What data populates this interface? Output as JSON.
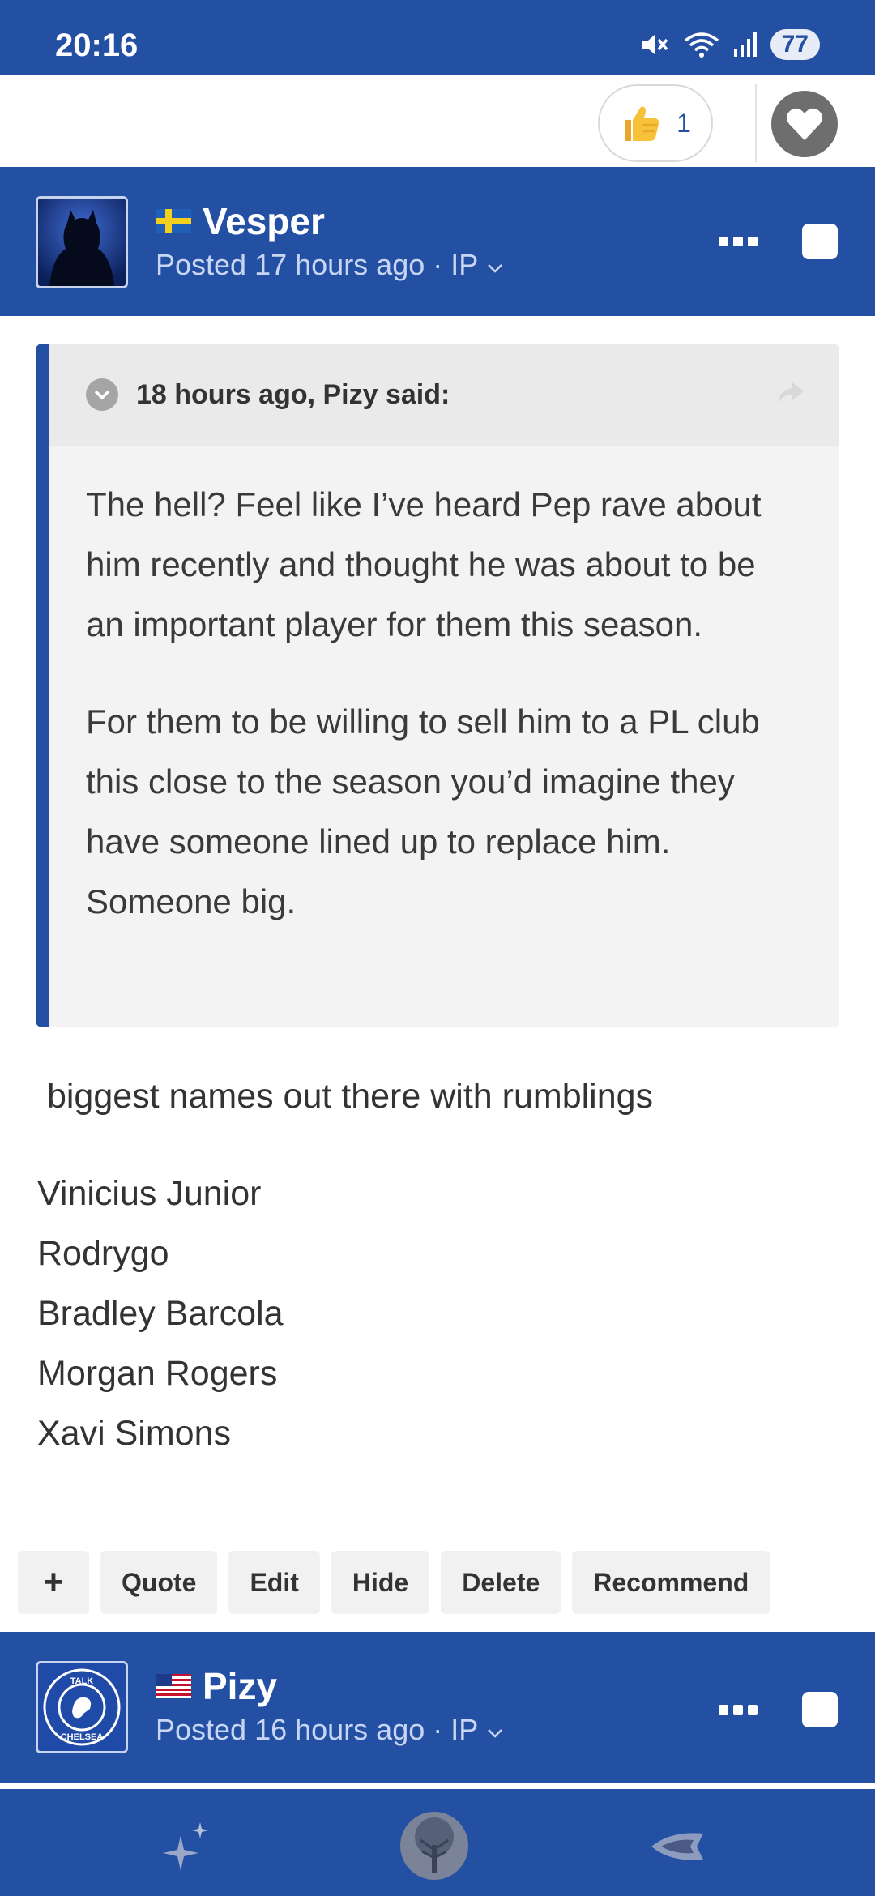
{
  "status_bar": {
    "time": "20:16",
    "battery": "77",
    "icons": [
      "mute-icon",
      "wifi-icon",
      "signal-icon"
    ]
  },
  "previous_post": {
    "reaction_count": "1",
    "reaction_icon": "thumbs-up-icon"
  },
  "posts": [
    {
      "author": "Vesper",
      "flag": "sweden-flag-icon",
      "posted": "Posted 17 hours ago · IP",
      "quote": {
        "citation": "18 hours ago, Pizy said:",
        "paragraphs": [
          "The hell? Feel like I’ve heard Pep rave about him recently and thought he was about to be an important player for them this season.",
          "For them to be willing to sell him to a PL club this close to the season you’d imagine they have someone lined up to replace him. Someone big."
        ]
      },
      "body": " biggest names out there with rumblings",
      "names": [
        "Vinicius Junior",
        "Rodrygo",
        "Bradley Barcola",
        "Morgan Rogers",
        "Xavi Simons"
      ],
      "actions": {
        "plus": "+",
        "quote": "Quote",
        "edit": "Edit",
        "hide": "Hide",
        "delete": "Delete",
        "recommend": "Recommend"
      }
    },
    {
      "author": "Pizy",
      "flag": "usa-flag-icon",
      "posted": "Posted 16 hours ago · IP",
      "avatar_text": [
        "TALK",
        "CHELSEA"
      ]
    }
  ],
  "colors": {
    "brand_blue": "#2450a4",
    "quote_bg": "#f3f3f3"
  },
  "bottom_nav": [
    "sparkle-icon",
    "tree-icon",
    "shuttle-icon"
  ]
}
